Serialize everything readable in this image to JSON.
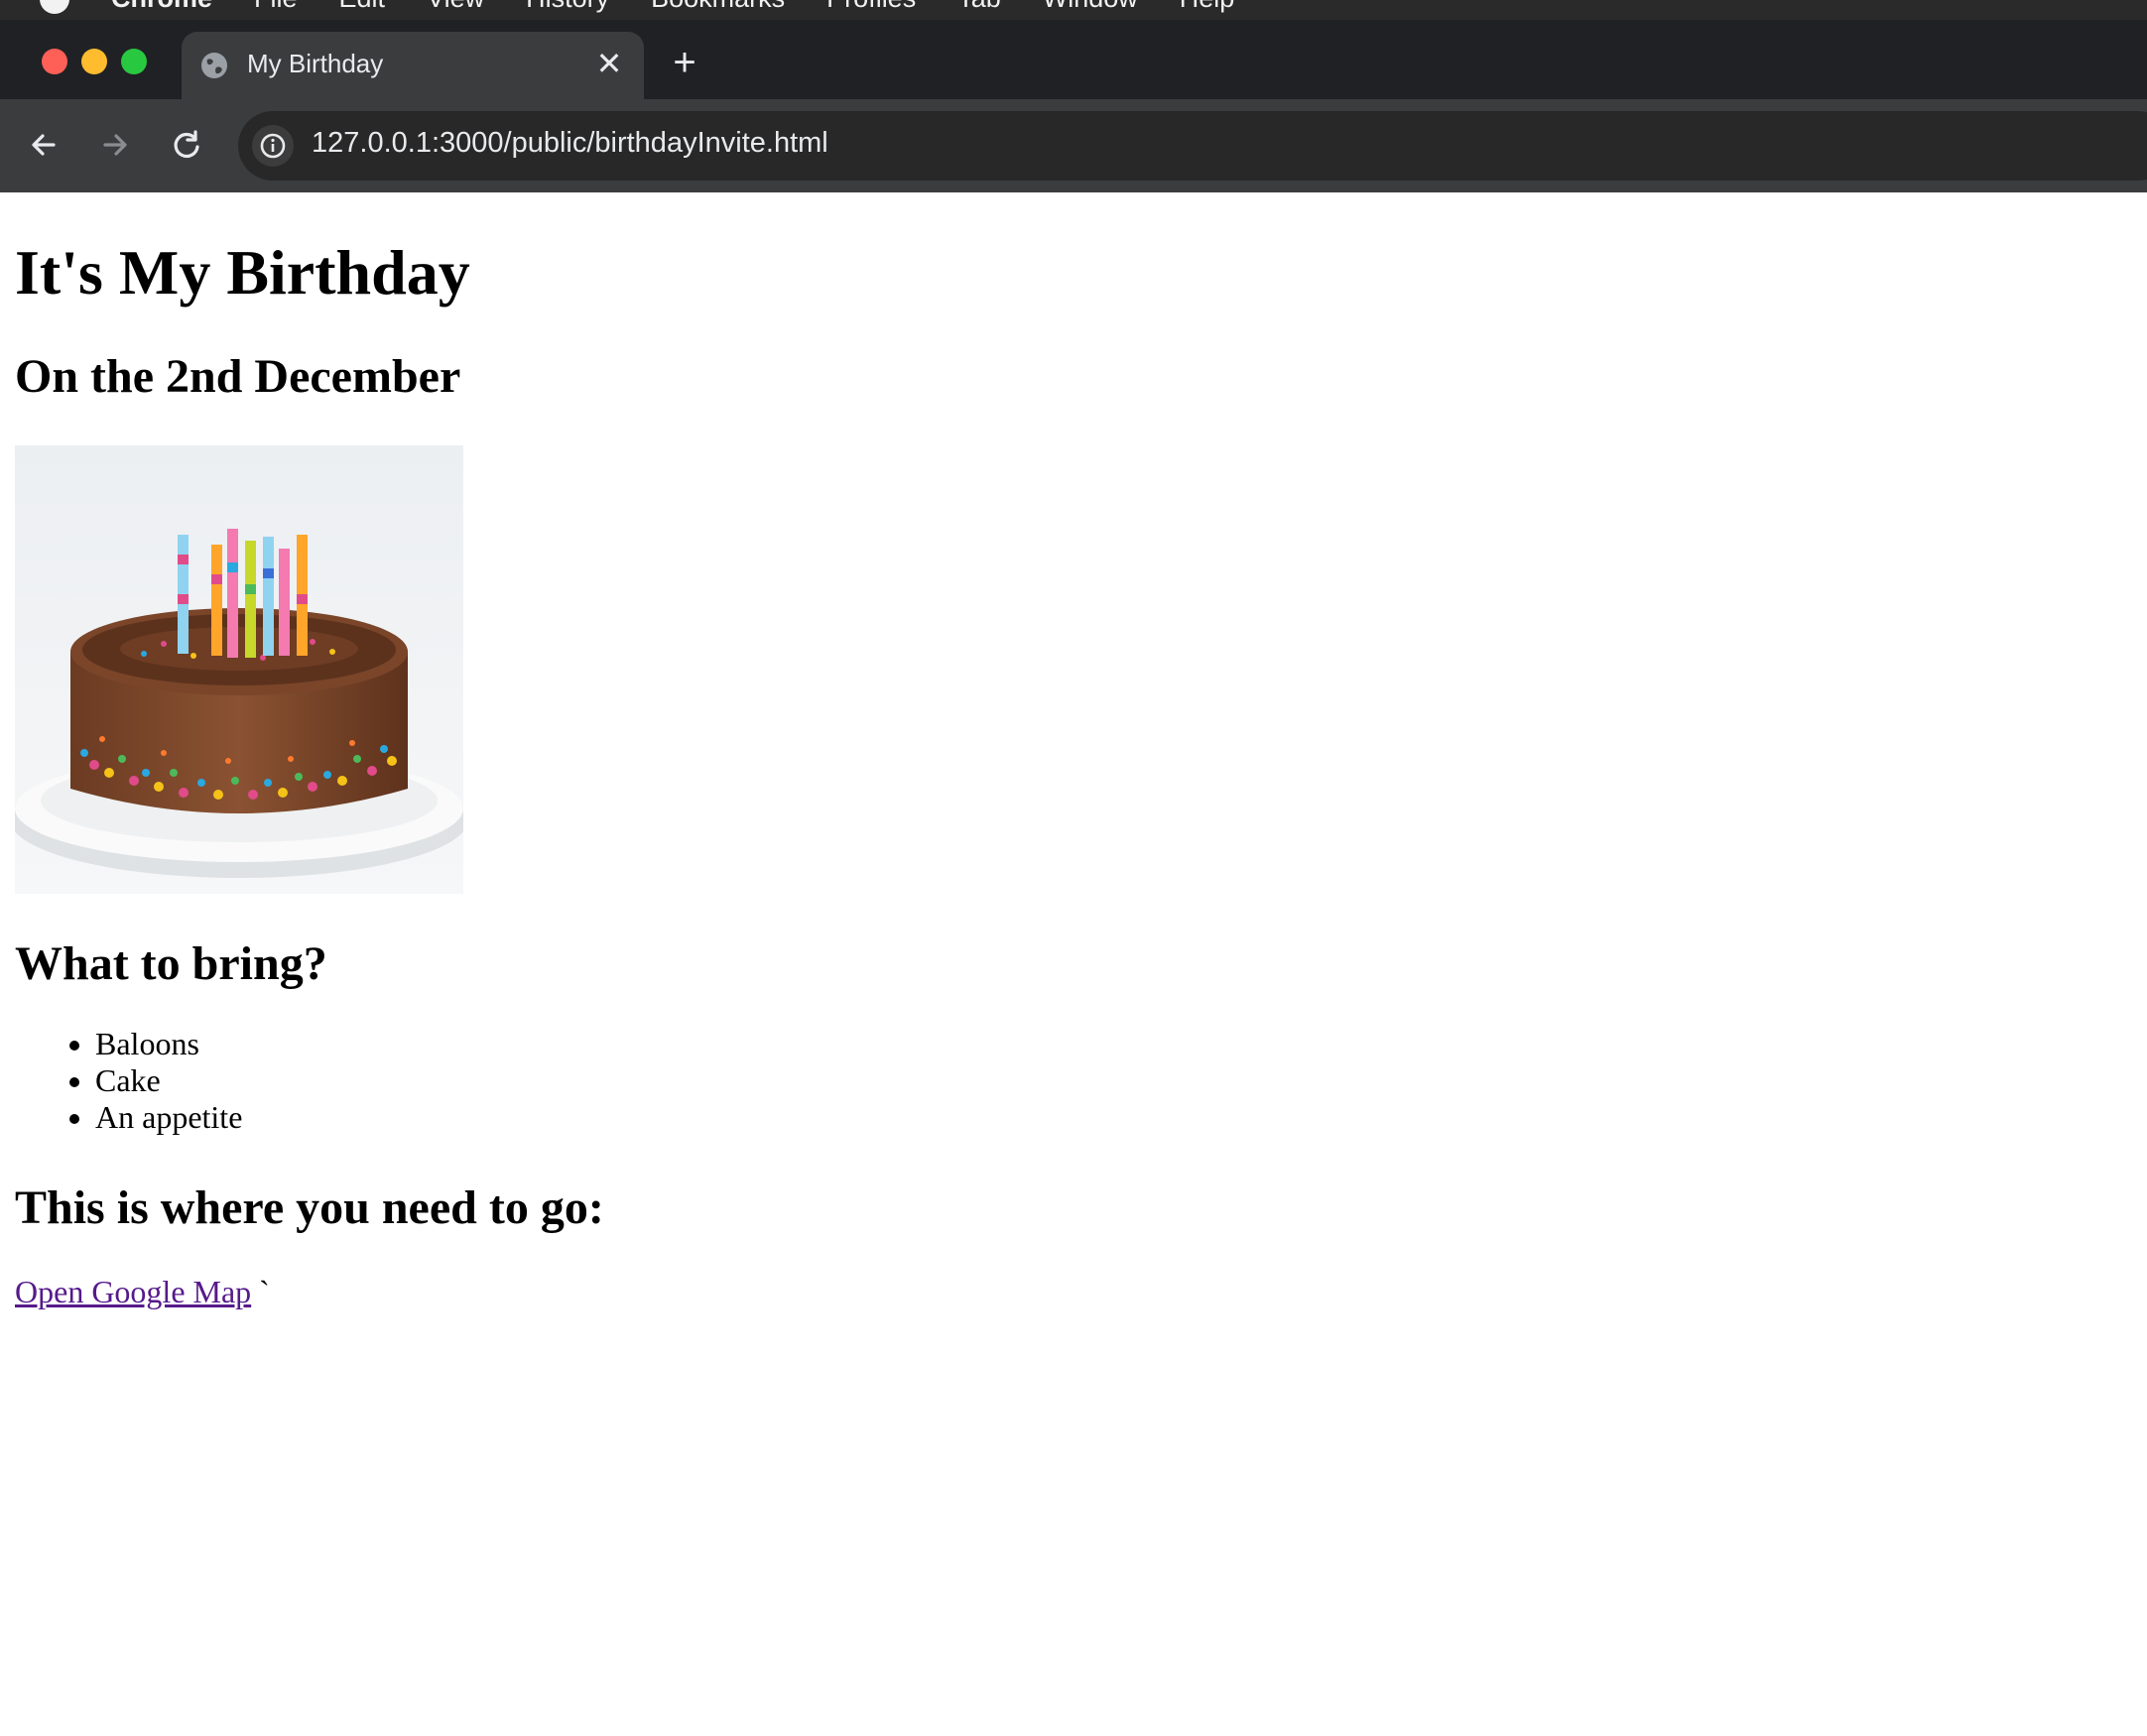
{
  "menubar": {
    "app_name": "Chrome",
    "items": [
      "File",
      "Edit",
      "View",
      "History",
      "Bookmarks",
      "Profiles",
      "Tab",
      "Window",
      "Help"
    ]
  },
  "browser": {
    "tab_title": "My Birthday",
    "url": "127.0.0.1:3000/public/birthdayInvite.html"
  },
  "page": {
    "title": "It's My Birthday",
    "date_heading": "On the 2nd December",
    "bring_heading": "What to bring?",
    "bring_items": [
      "Baloons",
      "Cake",
      "An appetite"
    ],
    "location_heading": "This is where you need to go:",
    "map_link": "Open Google Map",
    "stray_char": "`"
  },
  "colors": {
    "tab_strip": "#202124",
    "toolbar": "#3b3c3e",
    "link_visited": "#551a8b"
  }
}
